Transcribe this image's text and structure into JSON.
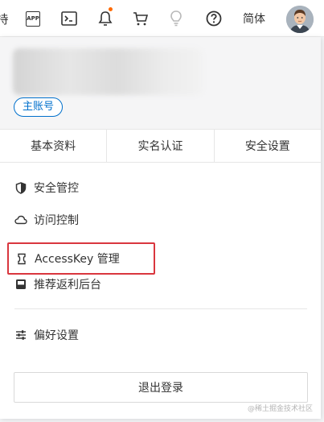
{
  "topbar": {
    "cut_text": "持",
    "app_label": "APP",
    "language": "简体",
    "icons": [
      "app-icon",
      "terminal-icon",
      "bell-icon",
      "cart-icon",
      "bulb-icon",
      "help-icon",
      "avatar"
    ],
    "notification_dot_color": "#ff6a00"
  },
  "profile": {
    "account_badge": "主账号",
    "badge_color": "#0070cc"
  },
  "tabs": [
    {
      "label": "基本资料"
    },
    {
      "label": "实名认证"
    },
    {
      "label": "安全设置"
    }
  ],
  "menu": [
    {
      "label": "安全管控",
      "icon": "shield-icon"
    },
    {
      "label": "访问控制",
      "icon": "cloud-icon"
    },
    {
      "label": "AccessKey 管理",
      "icon": "accesskey-icon",
      "highlighted": true
    },
    {
      "label": "推荐返利后台",
      "icon": "rebate-icon"
    },
    {
      "label": "偏好设置",
      "icon": "sliders-icon"
    }
  ],
  "highlight_color": "#d9363e",
  "logout_label": "退出登录",
  "watermark": "@稀土掘金技术社区"
}
